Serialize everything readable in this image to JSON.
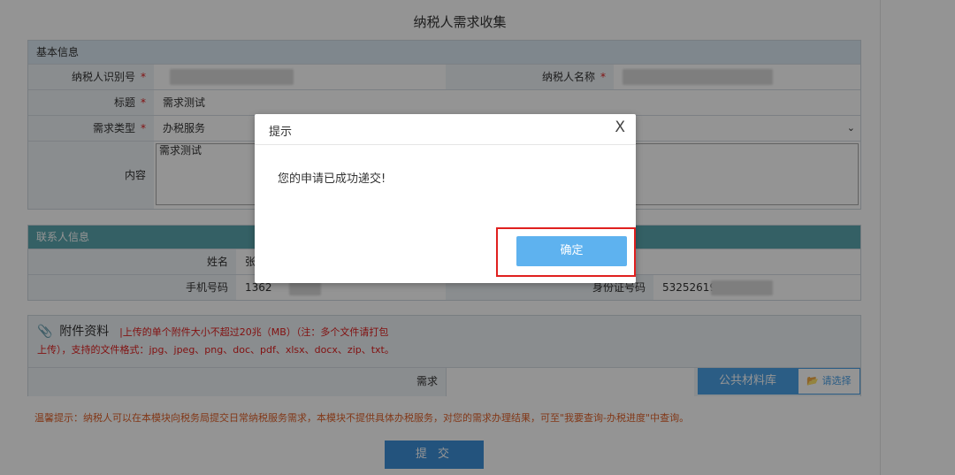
{
  "page_title": "纳税人需求收集",
  "basic_info": {
    "header": "基本信息",
    "taxpayer_id_label": "纳税人识别号",
    "taxpayer_name_label": "纳税人名称",
    "title_label": "标题",
    "title_value": "需求测试",
    "type_label": "需求类型",
    "type_value": "办税服务",
    "content_label": "内容",
    "content_value": "需求测试",
    "required_mark": "*"
  },
  "contact_info": {
    "header": "联系人信息",
    "name_label": "姓名",
    "name_value": "张",
    "phone_label": "手机号码",
    "phone_value": "1362",
    "id_label": "身份证号码",
    "id_value": "53252619"
  },
  "attachments": {
    "title": "附件资料",
    "note_line1": "|上传的单个附件大小不超过20兆（MB）（注：多个文件请打包",
    "note_line2": "上传），支持的文件格式：jpg、jpeg、png、doc、pdf、xlsx、docx、zip、txt。",
    "demand_label": "需求",
    "public_library_button": "公共材料库",
    "select_button": "请选择"
  },
  "tip_text": "温馨提示：纳税人可以在本模块向税务局提交日常纳税服务需求，本模块不提供具体办税服务，对您的需求办理结果，可至\"我要查询-办税进度\"中查询。",
  "submit_button": "提 交",
  "dialog": {
    "title": "提示",
    "close": "X",
    "message": "您的申请已成功递交!",
    "ok_button": "确定"
  },
  "colors": {
    "section_header_blue": "#dbe8f3",
    "section_header_teal": "#5aa6ae",
    "ok_button": "#5eb2ef",
    "highlight_red": "#e0201f",
    "submit_button": "#3d8fd8"
  },
  "icons": {
    "attachment": "paperclip-icon",
    "folder": "folder-open-icon",
    "dropdown": "chevron-down-icon"
  }
}
